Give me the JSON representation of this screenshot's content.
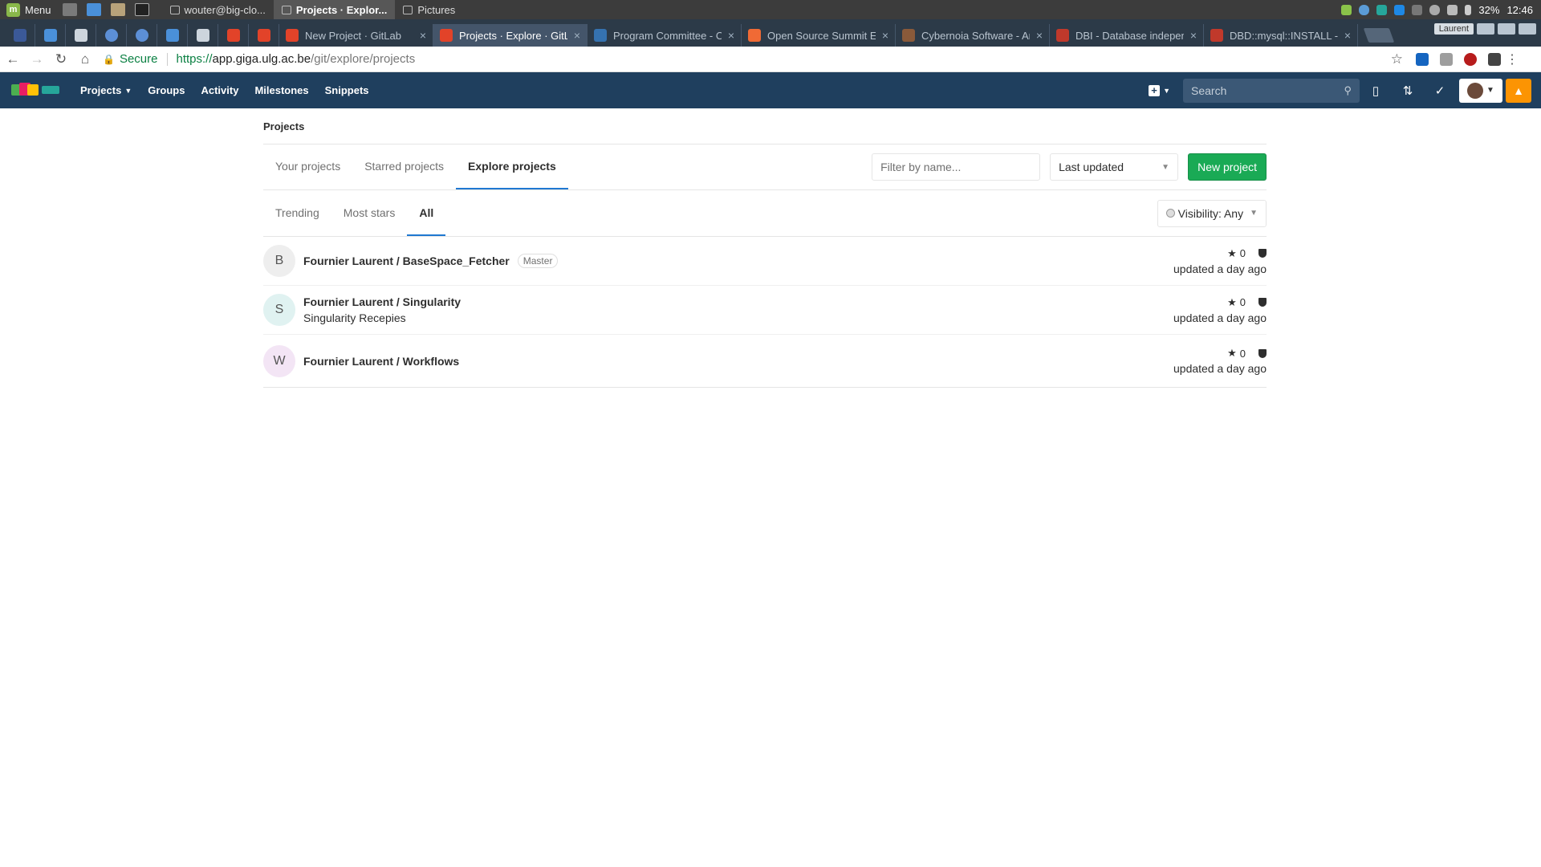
{
  "os_panel": {
    "menu_label": "Menu",
    "tasks": [
      {
        "label": "wouter@big-clo...",
        "active": false
      },
      {
        "label": "Projects · Explor...",
        "active": true
      },
      {
        "label": "Pictures",
        "active": false
      }
    ],
    "battery": "32%",
    "clock": "12:46"
  },
  "browser": {
    "tabs": [
      {
        "label": "New Project · GitLab",
        "active": false,
        "color": "#e24329"
      },
      {
        "label": "Projects · Explore · GitLab",
        "active": true,
        "color": "#e24329"
      },
      {
        "label": "Program Committee - O",
        "active": false,
        "color": "#3572b0"
      },
      {
        "label": "Open Source Summit E",
        "active": false,
        "color": "#f06a35"
      },
      {
        "label": "Cybernoia Software - Ar",
        "active": false,
        "color": "#8a5a3a"
      },
      {
        "label": "DBI - Database indepen",
        "active": false,
        "color": "#c0392b"
      },
      {
        "label": "DBD::mysql::INSTALL - s",
        "active": false,
        "color": "#c0392b"
      }
    ],
    "profile_name": "Laurent",
    "security_label": "Secure",
    "url_scheme": "https://",
    "url_host": "app.giga.ulg.ac.be",
    "url_path": "/git/explore/projects"
  },
  "gitlab_nav": {
    "links": [
      "Projects",
      "Groups",
      "Activity",
      "Milestones",
      "Snippets"
    ],
    "search_placeholder": "Search"
  },
  "page": {
    "breadcrumb": "Projects",
    "tabs": [
      {
        "label": "Your projects",
        "active": false
      },
      {
        "label": "Starred projects",
        "active": false
      },
      {
        "label": "Explore projects",
        "active": true
      }
    ],
    "filter_placeholder": "Filter by name...",
    "sort_label": "Last updated",
    "new_project_label": "New project",
    "subtabs": [
      {
        "label": "Trending",
        "active": false
      },
      {
        "label": "Most stars",
        "active": false
      },
      {
        "label": "All",
        "active": true
      }
    ],
    "visibility_label": "Visibility: Any"
  },
  "projects": [
    {
      "initial": "B",
      "name": "Fournier Laurent / BaseSpace_Fetcher",
      "badge": "Master",
      "description": "",
      "stars": "0",
      "updated": "updated a day ago",
      "avatar_color": "#eeeeee"
    },
    {
      "initial": "S",
      "name": "Fournier Laurent / Singularity",
      "badge": "",
      "description": "Singularity Recepies",
      "stars": "0",
      "updated": "updated a day ago",
      "avatar_color": "#e0f2f1"
    },
    {
      "initial": "W",
      "name": "Fournier Laurent / Workflows",
      "badge": "",
      "description": "",
      "stars": "0",
      "updated": "updated a day ago",
      "avatar_color": "#f3e5f5"
    }
  ]
}
